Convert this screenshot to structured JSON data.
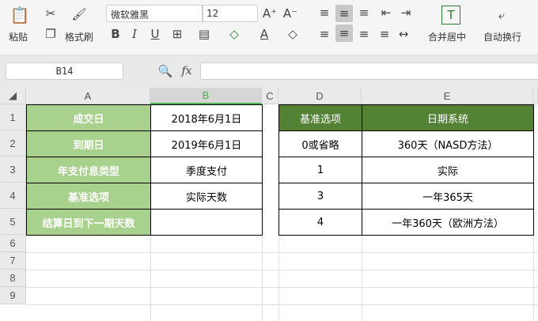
{
  "ribbon": {
    "paste": "粘贴",
    "format_painter": "格式刷",
    "font_name": "微软雅黑",
    "font_size": "12",
    "merge_center": "合并居中",
    "wrap_text": "自动换行"
  },
  "formula_bar": {
    "name_box": "B14",
    "fx": "fx",
    "formula": ""
  },
  "columns": [
    "A",
    "B",
    "C",
    "D",
    "E"
  ],
  "rows": [
    "1",
    "2",
    "3",
    "4",
    "5",
    "6",
    "7",
    "8",
    "9"
  ],
  "left_table": [
    {
      "label": "成交日",
      "value": "2018年6月1日"
    },
    {
      "label": "到期日",
      "value": "2019年6月1日"
    },
    {
      "label": "年支付息类型",
      "value": "季度支付"
    },
    {
      "label": "基准选项",
      "value": "实际天数"
    },
    {
      "label": "结算日到下一期天数",
      "value": ""
    }
  ],
  "right_table": {
    "headers": [
      "基准选项",
      "日期系统"
    ],
    "rows": [
      [
        "0或省略",
        "360天（NASD方法）"
      ],
      [
        "1",
        "实际"
      ],
      [
        "3",
        "一年365天"
      ],
      [
        "4",
        "一年360天（欧洲方法）"
      ]
    ]
  },
  "colors": {
    "label_green": "#a9d18e",
    "header_green": "#548235",
    "active_col": "#4caf50"
  }
}
